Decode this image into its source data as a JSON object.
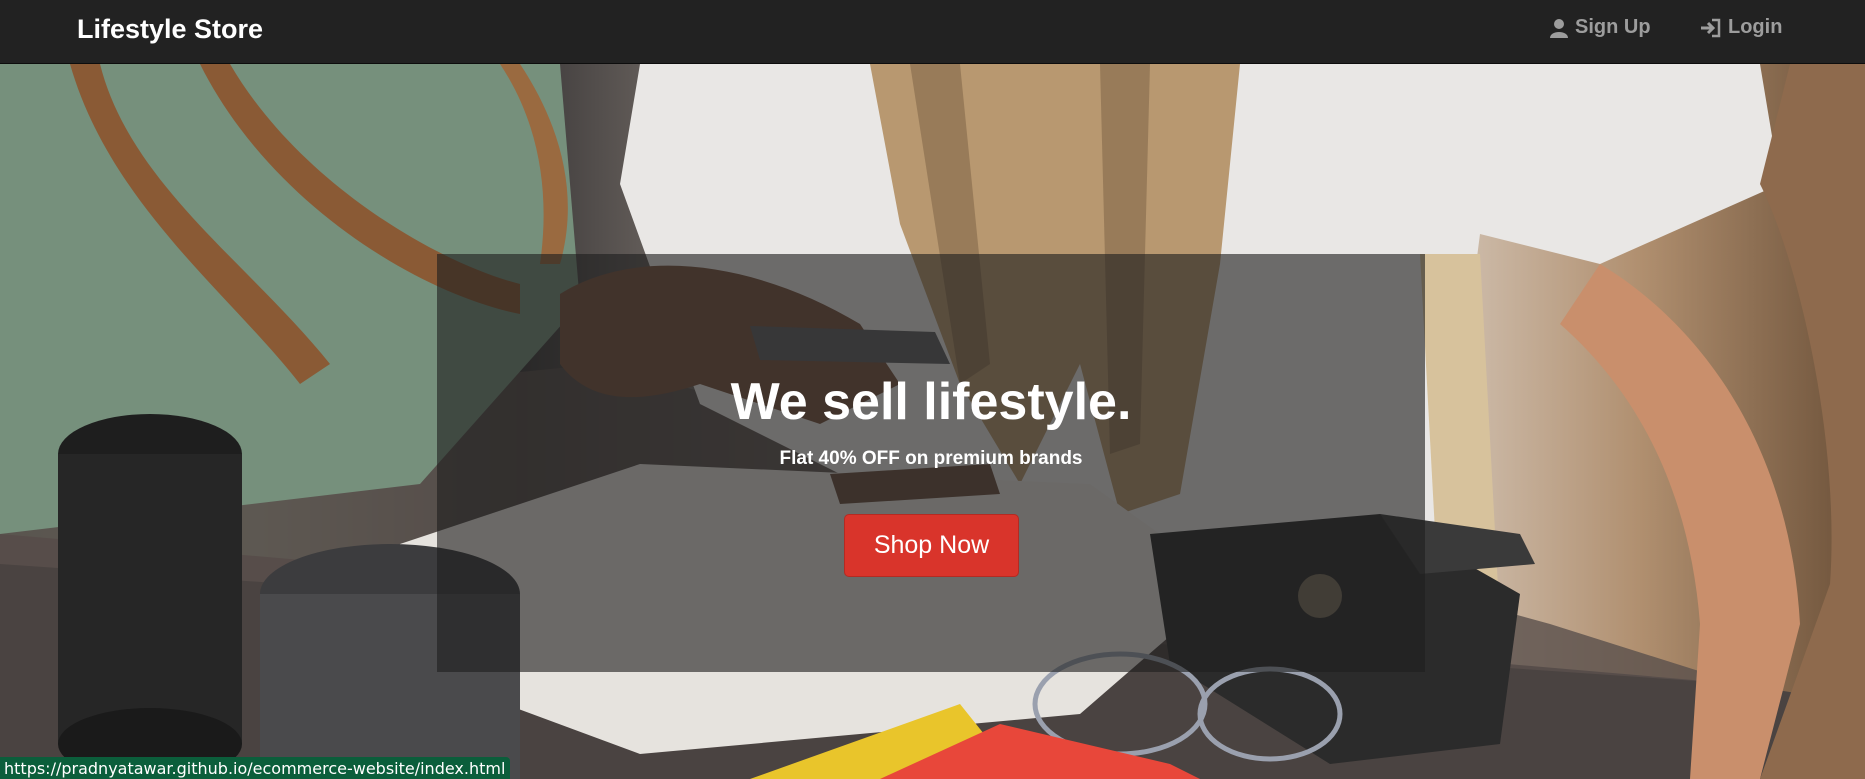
{
  "navbar": {
    "brand": "Lifestyle Store",
    "links": [
      {
        "label": "Sign Up",
        "icon": "user-icon"
      },
      {
        "label": "Login",
        "icon": "login-icon"
      }
    ]
  },
  "hero": {
    "headline": "We sell lifestyle.",
    "subheadline": "Flat 40% OFF on premium brands",
    "cta_label": "Shop Now",
    "cta_color": "#d9342b"
  },
  "status_bar": {
    "url": "https://pradnyatawar.github.io/ecommerce-website/index.html"
  }
}
